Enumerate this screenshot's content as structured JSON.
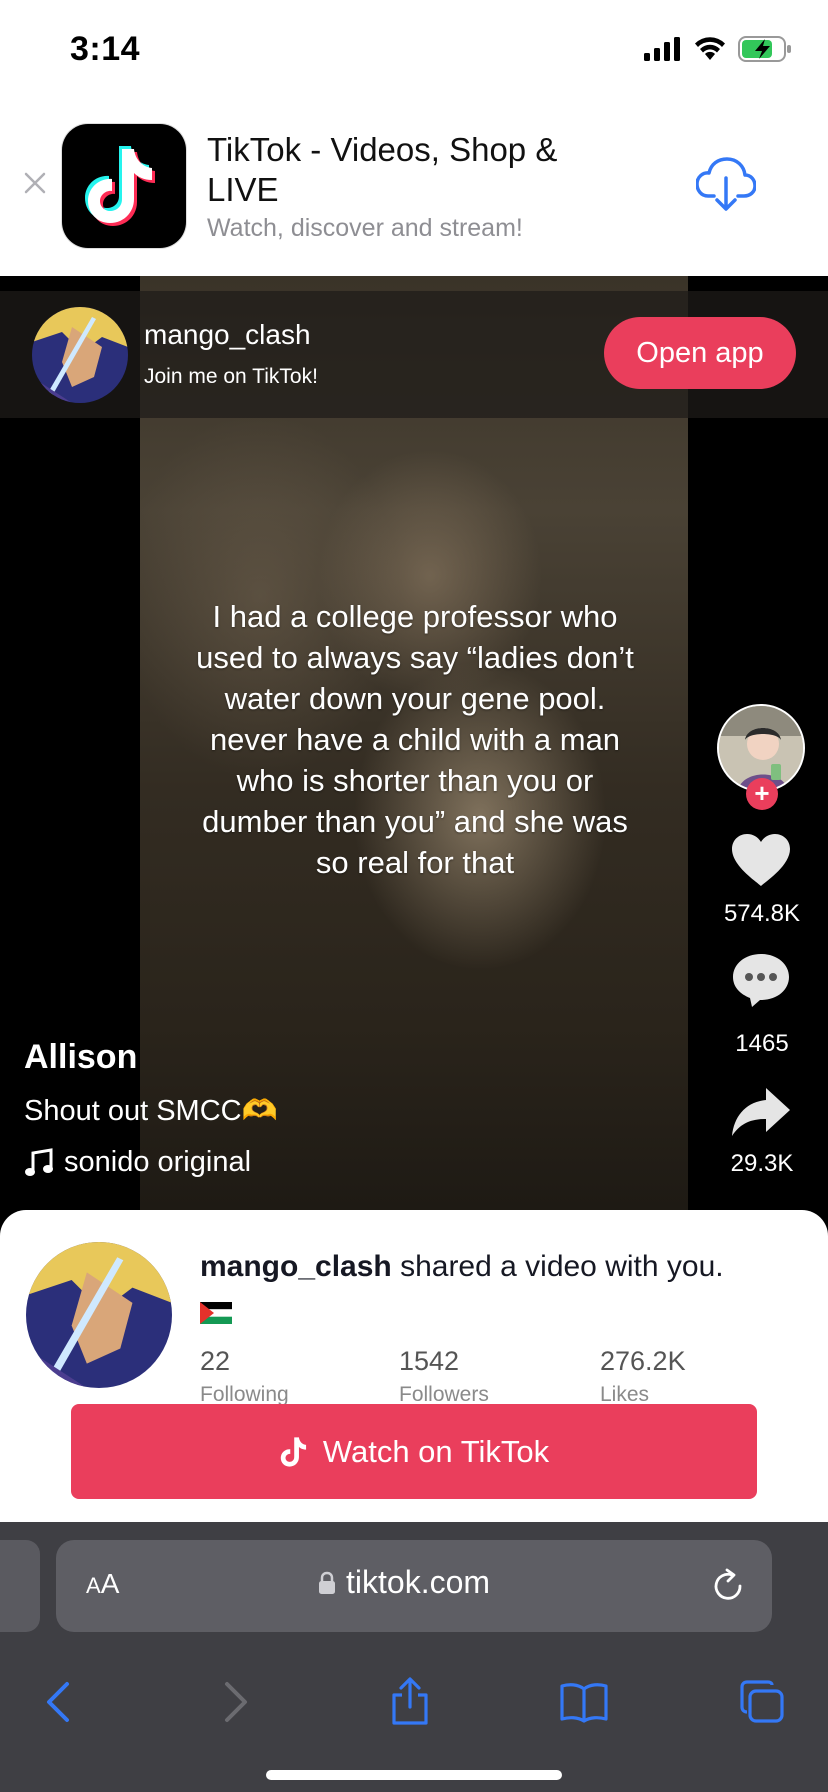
{
  "status_bar": {
    "time": "3:14"
  },
  "app_banner": {
    "title": "TikTok - Videos, Shop & LIVE",
    "subtitle": "Watch, discover and stream!"
  },
  "creator_bar": {
    "username": "mango_clash",
    "tagline": "Join me on TikTok!",
    "open_app_label": "Open app"
  },
  "video": {
    "caption": "I had a college professor who used to always say “ladies don’t water down your gene pool. never have a child with a man who is shorter than you or dumber than you” and she was so real for that",
    "author": "Allison",
    "description": "Shout out SMCC🫶",
    "sound": "sonido original",
    "likes": "574.8K",
    "comments": "1465",
    "shares": "29.3K"
  },
  "share_sheet": {
    "username": "mango_clash",
    "message": " shared a video with you.",
    "stats": [
      {
        "value": "22",
        "label": "Following"
      },
      {
        "value": "1542",
        "label": "Followers"
      },
      {
        "value": "276.2K",
        "label": "Likes"
      }
    ],
    "watch_label": "Watch on TikTok"
  },
  "browser": {
    "text_size_label": "AA",
    "url": "tiktok.com"
  },
  "colors": {
    "accent": "#ea3e5c",
    "ios_blue": "#3478f6",
    "toolbar": "#3f3f44"
  }
}
